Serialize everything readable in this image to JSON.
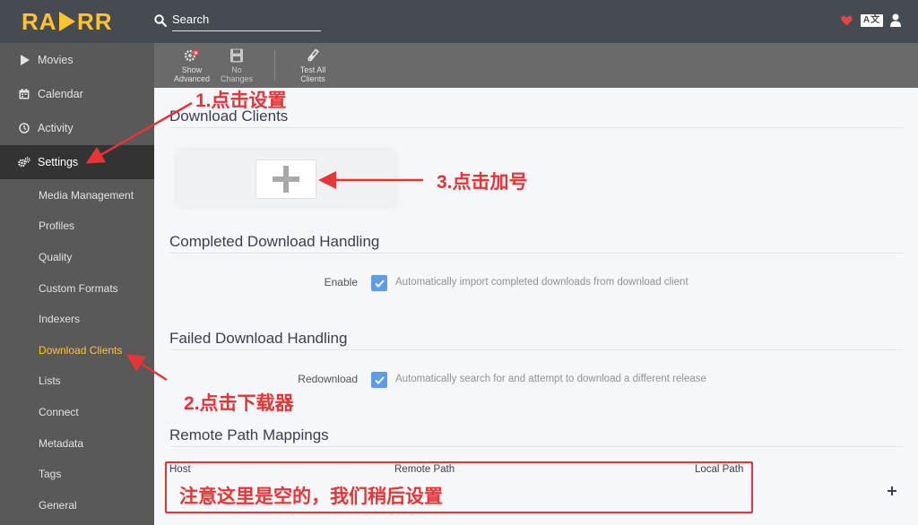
{
  "header": {
    "logo_text": "RADARR",
    "search": {
      "placeholder": "Search"
    }
  },
  "sidebar": {
    "items": [
      {
        "label": "Movies",
        "icon": "play-icon"
      },
      {
        "label": "Calendar",
        "icon": "calendar-icon"
      },
      {
        "label": "Activity",
        "icon": "clock-icon"
      },
      {
        "label": "Settings",
        "icon": "gears-icon"
      }
    ],
    "settings_sub": [
      "Media Management",
      "Profiles",
      "Quality",
      "Custom Formats",
      "Indexers",
      "Download Clients",
      "Lists",
      "Connect",
      "Metadata",
      "Tags",
      "General"
    ]
  },
  "toolbar": {
    "show_advanced": {
      "line1": "Show",
      "line2": "Advanced"
    },
    "no_changes": {
      "line1": "No",
      "line2": "Changes"
    },
    "test_all": {
      "line1": "Test All",
      "line2": "Clients"
    }
  },
  "main": {
    "download_clients_title": "Download Clients",
    "completed": {
      "title": "Completed Download Handling",
      "label": "Enable",
      "help": "Automatically import completed downloads from download client"
    },
    "failed": {
      "title": "Failed Download Handling",
      "label": "Redownload",
      "help": "Automatically search for and attempt to download a different release"
    },
    "remote": {
      "title": "Remote Path Mappings",
      "columns": [
        "Host",
        "Remote Path",
        "Local Path"
      ]
    }
  },
  "annotations": {
    "step1": "1.点击设置",
    "step2": "2.点击下载器",
    "step3": "3.点击加号",
    "note": "注意这里是空的，我们稍后设置"
  },
  "colors": {
    "header_bg": "#464b51",
    "sidebar_bg": "#595959",
    "active_nav_bg": "#333333",
    "accent_yellow": "#ffc230",
    "checkbox_blue": "#5d9cec",
    "annotation_red": "#e63537"
  }
}
